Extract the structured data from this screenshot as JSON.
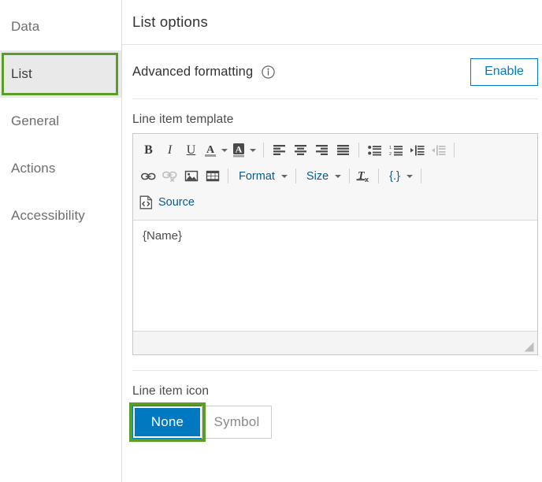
{
  "sidebar": {
    "items": [
      {
        "label": "Data",
        "name": "sidebar-item-data",
        "active": false
      },
      {
        "label": "List",
        "name": "sidebar-item-list",
        "active": true
      },
      {
        "label": "General",
        "name": "sidebar-item-general",
        "active": false
      },
      {
        "label": "Actions",
        "name": "sidebar-item-actions",
        "active": false
      },
      {
        "label": "Accessibility",
        "name": "sidebar-item-accessibility",
        "active": false
      }
    ]
  },
  "header": {
    "title": "List options"
  },
  "advanced_formatting": {
    "label": "Advanced formatting",
    "info_icon": "info-circle-icon",
    "enable_label": "Enable"
  },
  "line_item_template": {
    "label": "Line item template",
    "content": "{Name}",
    "toolbar": {
      "row1": [
        {
          "kind": "icon",
          "name": "bold-icon",
          "label": "B",
          "disabled": false
        },
        {
          "kind": "icon",
          "name": "italic-icon",
          "label": "I",
          "disabled": false
        },
        {
          "kind": "icon",
          "name": "underline-icon",
          "label": "U",
          "disabled": false
        },
        {
          "kind": "icon",
          "name": "text-color-icon",
          "label": "A",
          "disabled": false
        },
        {
          "kind": "caret",
          "name": "text-color-caret-icon",
          "label": "",
          "disabled": false
        },
        {
          "kind": "icon",
          "name": "background-color-icon",
          "label": "A",
          "disabled": false
        },
        {
          "kind": "caret",
          "name": "background-color-caret-icon",
          "label": "",
          "disabled": false
        },
        {
          "kind": "sep",
          "name": "toolbar-separator",
          "label": "",
          "disabled": false
        },
        {
          "kind": "icon",
          "name": "align-left-icon",
          "label": "",
          "disabled": false
        },
        {
          "kind": "icon",
          "name": "align-center-icon",
          "label": "",
          "disabled": false
        },
        {
          "kind": "icon",
          "name": "align-right-icon",
          "label": "",
          "disabled": false
        },
        {
          "kind": "icon",
          "name": "align-justify-icon",
          "label": "",
          "disabled": false
        },
        {
          "kind": "sep",
          "name": "toolbar-separator",
          "label": "",
          "disabled": false
        },
        {
          "kind": "icon",
          "name": "bulleted-list-icon",
          "label": "",
          "disabled": false
        },
        {
          "kind": "icon",
          "name": "numbered-list-icon",
          "label": "",
          "disabled": false
        },
        {
          "kind": "icon",
          "name": "increase-indent-icon",
          "label": "",
          "disabled": false
        },
        {
          "kind": "icon",
          "name": "decrease-indent-icon",
          "label": "",
          "disabled": true
        },
        {
          "kind": "sep",
          "name": "toolbar-separator",
          "label": "",
          "disabled": false
        }
      ],
      "row2": [
        {
          "kind": "icon",
          "name": "link-icon",
          "label": "",
          "disabled": false
        },
        {
          "kind": "icon",
          "name": "unlink-icon",
          "label": "",
          "disabled": true
        },
        {
          "kind": "icon",
          "name": "image-icon",
          "label": "",
          "disabled": false
        },
        {
          "kind": "icon",
          "name": "table-icon",
          "label": "",
          "disabled": false
        },
        {
          "kind": "sep",
          "name": "toolbar-separator",
          "label": "",
          "disabled": false
        },
        {
          "kind": "combo",
          "name": "format-dropdown",
          "label": "Format",
          "disabled": false
        },
        {
          "kind": "sep",
          "name": "toolbar-separator",
          "label": "",
          "disabled": false
        },
        {
          "kind": "combo",
          "name": "size-dropdown",
          "label": "Size",
          "disabled": false
        },
        {
          "kind": "sep",
          "name": "toolbar-separator",
          "label": "",
          "disabled": false
        },
        {
          "kind": "icon",
          "name": "remove-format-icon",
          "label": "",
          "disabled": false
        },
        {
          "kind": "sep",
          "name": "toolbar-separator",
          "label": "",
          "disabled": false
        },
        {
          "kind": "combo",
          "name": "field-dropdown",
          "label": "{.}",
          "disabled": false
        },
        {
          "kind": "sep",
          "name": "toolbar-separator",
          "label": "",
          "disabled": false
        }
      ],
      "source_label": "Source",
      "source_icon": "source-code-icon"
    }
  },
  "line_item_icon": {
    "label": "Line item icon",
    "options": [
      {
        "label": "None",
        "name": "line-item-icon-none-button",
        "selected": true
      },
      {
        "label": "Symbol",
        "name": "line-item-icon-symbol-button",
        "selected": false
      }
    ]
  },
  "colors": {
    "accent_blue": "#0079c1",
    "focus_green": "#5a9e28",
    "link_blue": "#0b5a8e",
    "text_dark": "#323232",
    "text_muted": "#6e6e6e",
    "sidebar_active_bg": "#e9e9e9",
    "toolbar_bg": "#f7f7f7"
  }
}
